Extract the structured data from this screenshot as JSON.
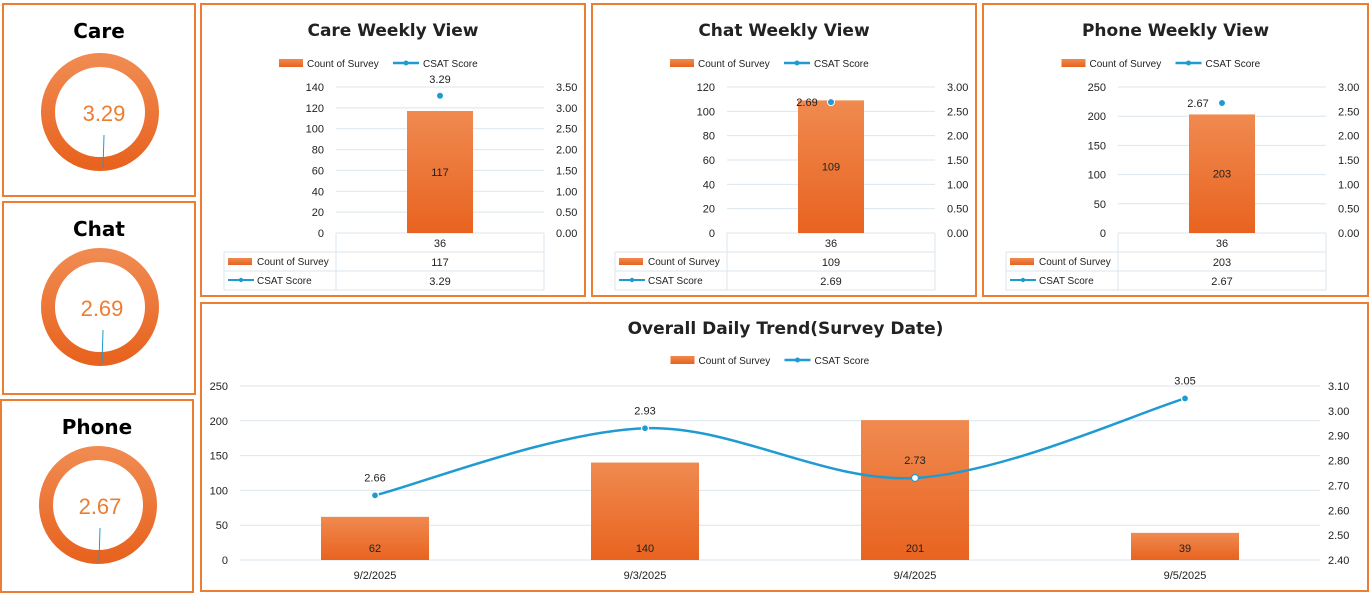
{
  "colors": {
    "accent": "#ED7D31",
    "bar_top": "#F08A50",
    "bar_bottom": "#E8631F",
    "line": "#1F9BD1",
    "grid": "#D9E6EE"
  },
  "kpis": [
    {
      "title": "Care",
      "value": "3.29"
    },
    {
      "title": "Chat",
      "value": "2.69"
    },
    {
      "title": "Phone",
      "value": "2.67"
    }
  ],
  "legend": {
    "count": "Count of Survey",
    "csat": "CSAT Score"
  },
  "chart_data": [
    {
      "type": "bar",
      "title": "Care Weekly View",
      "categories": [
        "36"
      ],
      "series": [
        {
          "name": "Count of Survey",
          "type": "bar",
          "axis": "left",
          "values": [
            117
          ]
        },
        {
          "name": "CSAT Score",
          "type": "line",
          "axis": "right",
          "values": [
            3.29
          ]
        }
      ],
      "ylim_left": [
        0,
        140
      ],
      "ylim_right": [
        0,
        3.5
      ],
      "yticks_left": [
        "0",
        "20",
        "40",
        "60",
        "80",
        "100",
        "120",
        "140"
      ],
      "yticks_right": [
        "0.00",
        "0.50",
        "1.00",
        "1.50",
        "2.00",
        "2.50",
        "3.00",
        "3.50"
      ],
      "table": {
        "rows": [
          {
            "label": "Count of Survey",
            "value": "117"
          },
          {
            "label": "CSAT Score",
            "value": "3.29"
          }
        ]
      }
    },
    {
      "type": "bar",
      "title": "Chat Weekly View",
      "categories": [
        "36"
      ],
      "series": [
        {
          "name": "Count of Survey",
          "type": "bar",
          "axis": "left",
          "values": [
            109
          ]
        },
        {
          "name": "CSAT Score",
          "type": "line",
          "axis": "right",
          "values": [
            2.69
          ]
        }
      ],
      "ylim_left": [
        0,
        120
      ],
      "ylim_right": [
        0,
        3.0
      ],
      "yticks_left": [
        "0",
        "20",
        "40",
        "60",
        "80",
        "100",
        "120"
      ],
      "yticks_right": [
        "0.00",
        "0.50",
        "1.00",
        "1.50",
        "2.00",
        "2.50",
        "3.00"
      ],
      "table": {
        "rows": [
          {
            "label": "Count of Survey",
            "value": "109"
          },
          {
            "label": "CSAT Score",
            "value": "2.69"
          }
        ]
      }
    },
    {
      "type": "bar",
      "title": "Phone Weekly View",
      "categories": [
        "36"
      ],
      "series": [
        {
          "name": "Count of Survey",
          "type": "bar",
          "axis": "left",
          "values": [
            203
          ]
        },
        {
          "name": "CSAT Score",
          "type": "line",
          "axis": "right",
          "values": [
            2.67
          ]
        }
      ],
      "ylim_left": [
        0,
        250
      ],
      "ylim_right": [
        0,
        3.0
      ],
      "yticks_left": [
        "0",
        "50",
        "100",
        "150",
        "200",
        "250"
      ],
      "yticks_right": [
        "0.00",
        "0.50",
        "1.00",
        "1.50",
        "2.00",
        "2.50",
        "3.00"
      ],
      "table": {
        "rows": [
          {
            "label": "Count of Survey",
            "value": "203"
          },
          {
            "label": "CSAT Score",
            "value": "2.67"
          }
        ]
      }
    },
    {
      "type": "bar",
      "title": "Overall Daily Trend(Survey Date)",
      "categories": [
        "9/2/2025",
        "9/3/2025",
        "9/4/2025",
        "9/5/2025"
      ],
      "series": [
        {
          "name": "Count of Survey",
          "type": "bar",
          "axis": "left",
          "values": [
            62,
            140,
            201,
            39
          ]
        },
        {
          "name": "CSAT Score",
          "type": "line",
          "axis": "right",
          "values": [
            2.66,
            2.93,
            2.73,
            3.05
          ]
        }
      ],
      "ylim_left": [
        0,
        250
      ],
      "ylim_right": [
        2.4,
        3.1
      ],
      "yticks_left": [
        "0",
        "50",
        "100",
        "150",
        "200",
        "250"
      ],
      "yticks_right": [
        "2.40",
        "2.50",
        "2.60",
        "2.70",
        "2.80",
        "2.90",
        "3.00",
        "3.10"
      ]
    }
  ]
}
